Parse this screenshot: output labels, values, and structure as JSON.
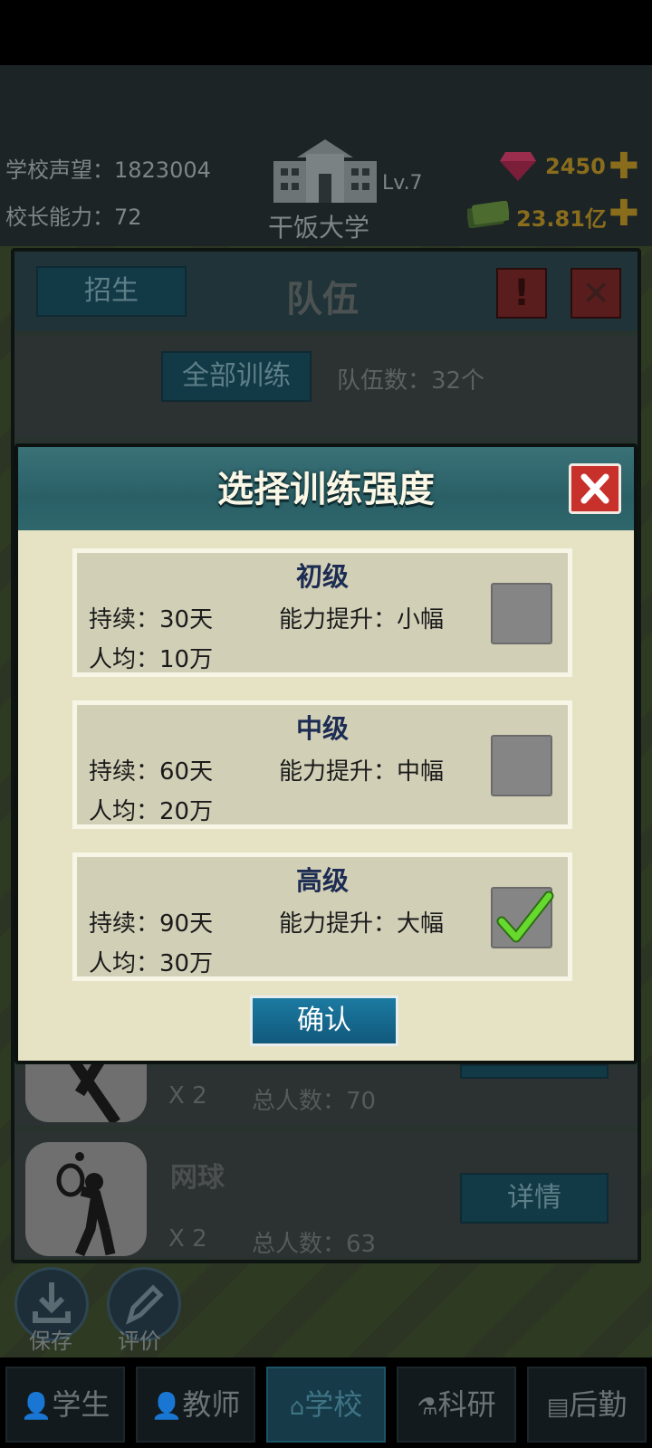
{
  "header": {
    "reputation_label": "学校声望：",
    "reputation_value": "1823004",
    "principal_label": "校长能力：",
    "principal_value": "72",
    "school_name": "干饭大学",
    "school_level": "Lv.7",
    "gems": "2450",
    "money": "23.81亿"
  },
  "team_panel": {
    "recruit_label": "招生",
    "title": "队伍",
    "train_all_label": "全部训练",
    "team_count_label": "队伍数：",
    "team_count_value": "32个",
    "rows": [
      {
        "multiplier": "X 2",
        "total_label": "总人数：",
        "total_value": "70"
      },
      {
        "name": "网球",
        "multiplier": "X 2",
        "total_label": "总人数：",
        "total_value": "63",
        "detail_label": "详情"
      }
    ]
  },
  "modal": {
    "title": "选择训练强度",
    "options": [
      {
        "level": "初级",
        "duration_label": "持续：",
        "duration_value": "30天",
        "boost_label": "能力提升：",
        "boost_value": "小幅",
        "cost_label": "人均：",
        "cost_value": "10万",
        "selected": false
      },
      {
        "level": "中级",
        "duration_label": "持续：",
        "duration_value": "60天",
        "boost_label": "能力提升：",
        "boost_value": "中幅",
        "cost_label": "人均：",
        "cost_value": "20万",
        "selected": false
      },
      {
        "level": "高级",
        "duration_label": "持续：",
        "duration_value": "90天",
        "boost_label": "能力提升：",
        "boost_value": "大幅",
        "cost_label": "人均：",
        "cost_value": "30万",
        "selected": true
      }
    ],
    "confirm_label": "确认"
  },
  "side_buttons": {
    "save_label": "保存",
    "rate_label": "评价"
  },
  "nav": {
    "tabs": [
      "学生",
      "教师",
      "学校",
      "科研",
      "后勤"
    ],
    "active": "学校"
  },
  "colors": {
    "accent_gold": "#8a6d1c",
    "modal_bg": "#e6e3c5",
    "confirm_blue": "#1c7aa1",
    "close_red": "#c8302c",
    "check_green": "#5ed02a"
  }
}
